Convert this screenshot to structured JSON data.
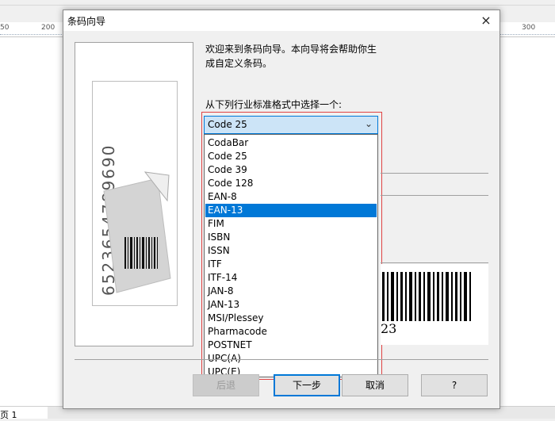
{
  "background": {
    "ruler_labels": [
      "50",
      "200",
      "300"
    ],
    "status_text": "页 1"
  },
  "dialog": {
    "title": "条码向导",
    "close_glyph": "×",
    "welcome_text": "欢迎来到条码向导。本向导将会帮助你生成自定义条码。",
    "prompt_label": "从下列行业标准格式中选择一个:",
    "combo": {
      "selected_value": "Code 25",
      "arrow_glyph": "⌄"
    },
    "dropdown": {
      "highlighted": "EAN-13",
      "options": [
        "CodaBar",
        "Code 25",
        "Code 39",
        "Code 128",
        "EAN-8",
        "EAN-13",
        "FIM",
        "ISBN",
        "ISSN",
        "ITF",
        "ITF-14",
        "JAN-8",
        "JAN-13",
        "MSI/Plessey",
        "Pharmacode",
        "POSTNET",
        "UPC(A)",
        "UPC(E)"
      ]
    },
    "sample_digits": "6523654789690",
    "preview_digits_visible": "23",
    "buttons": {
      "back": "后退",
      "next": "下一步",
      "cancel": "取消",
      "help": "?"
    }
  },
  "colors": {
    "accent": "#0078d7",
    "combo_bg": "#cce4f7",
    "outline_red": "#e04343"
  }
}
